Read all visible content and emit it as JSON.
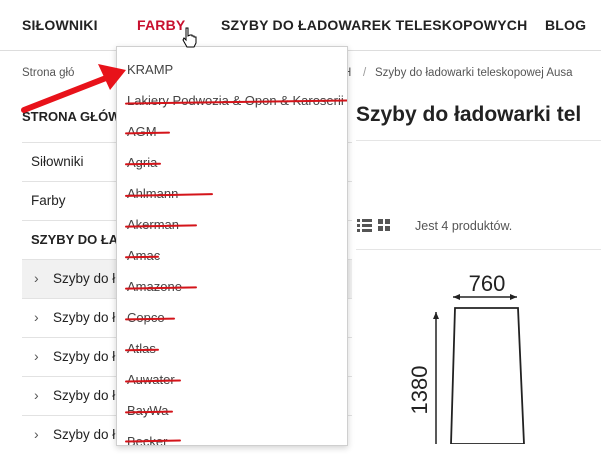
{
  "nav": {
    "items": [
      {
        "label": "SIŁOWNIKI"
      },
      {
        "label": "FARBY"
      },
      {
        "label": "SZYBY DO ŁADOWAREK TELESKOPOWYCH"
      },
      {
        "label": "BLOG"
      }
    ],
    "active": "FARBY",
    "accent_color": "#c8102e"
  },
  "breadcrumb": {
    "items": [
      "Strona głó",
      "H",
      "Szyby do ładowarki teleskopowej Ausa"
    ],
    "separator": "/"
  },
  "sidebar": {
    "title": "STRONA GŁÓW",
    "items": [
      {
        "label": "Siłowniki"
      },
      {
        "label": "Farby"
      },
      {
        "label": "SZYBY DO ŁA"
      },
      {
        "label": "Szyby do ł"
      },
      {
        "label": "Szyby do ł"
      },
      {
        "label": "Szyby do ł"
      },
      {
        "label": "Szyby do ł"
      },
      {
        "label": "Szyby do ł"
      }
    ]
  },
  "main": {
    "title": "Szyby do ładowarki tel",
    "product_count": "Jest 4 produktów.",
    "view_icons": [
      "list-view-icon",
      "grid-view-icon"
    ],
    "drawing": {
      "width_label": "760",
      "height_label": "1380"
    }
  },
  "dropdown": {
    "items": [
      {
        "label": "KRAMP",
        "struck": false
      },
      {
        "label": "Lakiery Podwozia & Opon & Karoserii",
        "struck": true
      },
      {
        "label": "AGM",
        "struck": true
      },
      {
        "label": "Agria",
        "struck": true
      },
      {
        "label": "Ahlmann",
        "struck": true
      },
      {
        "label": "Akerman",
        "struck": true
      },
      {
        "label": "Amac",
        "struck": true
      },
      {
        "label": "Amazone",
        "struck": true
      },
      {
        "label": "Copco",
        "struck": true
      },
      {
        "label": "Atlas",
        "struck": true
      },
      {
        "label": "Auwater",
        "struck": true
      },
      {
        "label": "BayWa",
        "struck": true
      },
      {
        "label": "Becker",
        "struck": true
      }
    ],
    "strike_color": "#d4141a"
  },
  "annotation": {
    "arrow_color": "#e8121a",
    "arrow_icon": "red-arrow-icon"
  }
}
